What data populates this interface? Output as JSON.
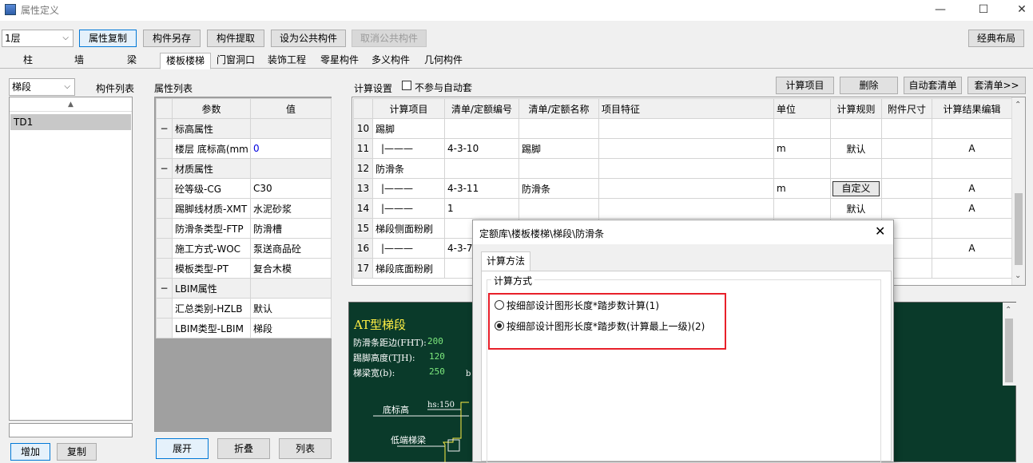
{
  "window": {
    "title": "属性定义",
    "min": "—",
    "max": "☐",
    "close": "✕"
  },
  "toolbar": {
    "floor": "1层",
    "buttons": [
      "属性复制",
      "构件另存",
      "构件提取",
      "设为公共构件",
      "取消公共构件"
    ],
    "classic_layout": "经典布局"
  },
  "tabs": [
    "柱",
    "墙",
    "梁",
    "楼板楼梯",
    "门窗洞口",
    "装饰工程",
    "零星构件",
    "多义构件",
    "几何构件"
  ],
  "left": {
    "type_select": "梯段",
    "list_title": "构件列表",
    "items": [
      "TD1"
    ],
    "add": "增加",
    "copy": "复制"
  },
  "props": {
    "title": "属性列表",
    "col_param": "参数",
    "col_value": "值",
    "rows": [
      {
        "group": "标高属性",
        "toggle": "−"
      },
      {
        "param": "楼层 底标高(mm",
        "value": "0",
        "blue": true
      },
      {
        "group": "材质属性",
        "toggle": "−"
      },
      {
        "param": "砼等级-CG",
        "value": "C30"
      },
      {
        "param": "踢脚线材质-XMT",
        "value": "水泥砂浆"
      },
      {
        "param": "防滑条类型-FTP",
        "value": "防滑槽"
      },
      {
        "param": "施工方式-WOC",
        "value": "泵送商品砼"
      },
      {
        "param": "模板类型-PT",
        "value": "复合木模"
      },
      {
        "group": "LBIM属性",
        "toggle": "−"
      },
      {
        "param": "汇总类别-HZLB",
        "value": "默认"
      },
      {
        "param": "LBIM类型-LBIM",
        "value": "梯段"
      }
    ],
    "expand": "展开",
    "collapse": "折叠",
    "list": "列表"
  },
  "calc": {
    "title": "计算设置",
    "no_auto": "不参与自动套",
    "buttons": [
      "计算项目",
      "删除",
      "自动套清单",
      "套清单>>"
    ],
    "headers": [
      "计算项目",
      "清单/定额编号",
      "清单/定额名称",
      "项目特征",
      "单位",
      "计算规则",
      "附件尺寸",
      "计算结果编辑"
    ],
    "rows": [
      {
        "n": "10",
        "item": "踢脚",
        "code": "",
        "name": "",
        "unit": "",
        "rule": "",
        "res": ""
      },
      {
        "n": "11",
        "item": "|———",
        "code": "4-3-10",
        "name": "踢脚",
        "unit": "m",
        "rule": "默认",
        "res": "A"
      },
      {
        "n": "12",
        "item": "防滑条",
        "code": "",
        "name": "",
        "unit": "",
        "rule": "",
        "res": ""
      },
      {
        "n": "13",
        "item": "|———",
        "code": "4-3-11",
        "name": "防滑条",
        "unit": "m",
        "rule": "自定义",
        "res": "A"
      },
      {
        "n": "14",
        "item": "|———",
        "code": "1",
        "name": "",
        "unit": "",
        "rule": "默认",
        "res": "A"
      },
      {
        "n": "15",
        "item": "梯段侧面粉刷",
        "code": "",
        "name": "",
        "unit": "",
        "rule": "",
        "res": ""
      },
      {
        "n": "16",
        "item": "|———",
        "code": "4-3-7",
        "name": "",
        "unit": "",
        "rule": "",
        "res": "A"
      },
      {
        "n": "17",
        "item": "梯段底面粉刷",
        "code": "",
        "name": "",
        "unit": "",
        "rule": "",
        "res": ""
      }
    ]
  },
  "drawing": {
    "title": "AT型梯段",
    "labels": [
      {
        "text": "防滑条距边(FHT):",
        "value": "200"
      },
      {
        "text": "踢脚高度(TJH):",
        "value": "120"
      },
      {
        "text": "梯梁宽(b):",
        "value": "250"
      }
    ],
    "bottom_elev": "底标高",
    "low_beam": "低端梯梁",
    "hs": "hs:150",
    "b": "b"
  },
  "dialog": {
    "title": "定额库\\楼板楼梯\\梯段\\防滑条",
    "tab": "计算方法",
    "group": "计算方式",
    "options": [
      {
        "label": "按细部设计图形长度*踏步数计算(1)",
        "checked": false
      },
      {
        "label": "按细部设计图形长度*踏步数(计算最上一级)(2)",
        "checked": true
      }
    ]
  },
  "colors": {
    "accent": "#0078d7",
    "highlight": "#e8202a",
    "drawing_bg": "#0a3a2a"
  }
}
